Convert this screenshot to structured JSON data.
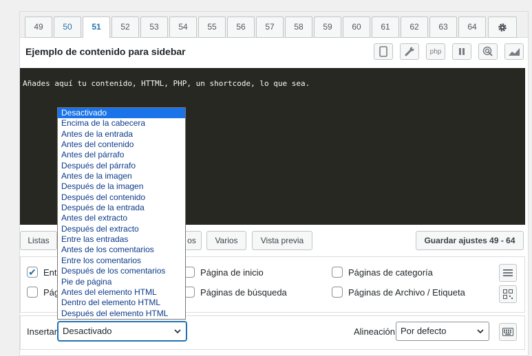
{
  "tabs": [
    "49",
    "50",
    "51",
    "52",
    "53",
    "54",
    "55",
    "56",
    "57",
    "58",
    "59",
    "60",
    "61",
    "62",
    "63",
    "64"
  ],
  "active_tab": "51",
  "title": "Ejemplo de contenido para sidebar",
  "toolbar": {
    "php_label": "php"
  },
  "editor_text": "Añades aquí tu contenido, HTTML, PHP, un shortcode, lo que sea.",
  "buttons": {
    "lists": "Listas",
    "partial": "os",
    "misc": "Varios",
    "preview": "Vista previa",
    "save": "Guardar ajustes 49 - 64"
  },
  "options": {
    "entries": "Entr",
    "pages": "Pág",
    "home": "Página de inicio",
    "category": "Páginas de categoría",
    "search": "Páginas de búsqueda",
    "archive": "Páginas de Archivo / Etiqueta"
  },
  "insert": {
    "label": "Insertar",
    "value": "Desactivado"
  },
  "alignment": {
    "label": "Alineación",
    "value": "Por defecto"
  },
  "dropdown_options": [
    "Desactivado",
    "Encima de la cabecera",
    "Antes de la entrada",
    "Antes del contenido",
    "Antes del párrafo",
    "Después del párrafo",
    "Antes de la imagen",
    "Después de la imagen",
    "Después del contenido",
    "Después de la entrada",
    "Antes del extracto",
    "Después del extracto",
    "Entre las entradas",
    "Antes de los comentarios",
    "Entre los comentarios",
    "Después de los comentarios",
    "Pie de página",
    "Antes del elemento HTML",
    "Dentro del elemento HTML",
    "Después del elemento HTML"
  ],
  "colors": {
    "accent": "#2271b1",
    "editor_bg": "#272822",
    "highlight": "#1a73e8"
  }
}
